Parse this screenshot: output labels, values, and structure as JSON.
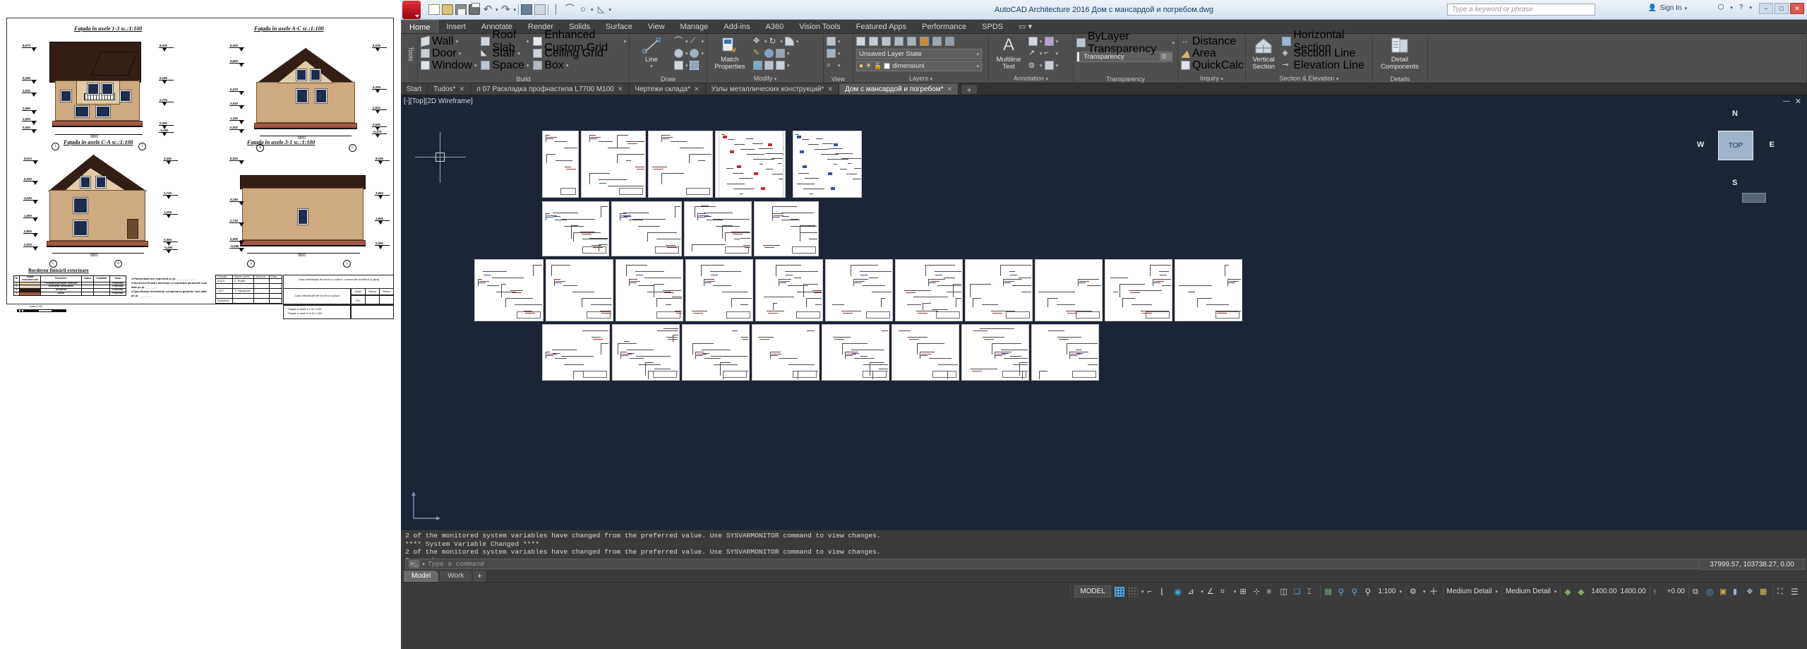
{
  "left_document": {
    "name": "facade-drawing-sheet",
    "titles": [
      "Fațada în axele 1-3 sc.:1:100",
      "Fațada în axele A-C sc.:1:100",
      "Fațada în axele C-A sc.:1:100",
      "Fațada în axele 3-1 sc.:1:100"
    ],
    "elev_left_1": [
      "8,070",
      "5,180",
      "3,930",
      "2,590",
      "1,500",
      "0,000"
    ],
    "elev_right_1": [
      "8,030",
      "5,180",
      "2,730",
      "0,000",
      "-0,450"
    ],
    "elev_left_2": [
      "8,000",
      "5,690",
      "5,220",
      "3,020",
      "1,150",
      "0,000"
    ],
    "elev_right_2": [
      "8,035",
      "5,205",
      "2,910",
      "0,000",
      "-0,470"
    ],
    "elev_left_3": [
      "8,023",
      "5,320",
      "3,020",
      "1,500",
      "0,800",
      "0,000"
    ],
    "elev_right_3": [
      "4,450",
      "2,730",
      "1,205",
      "0,000",
      "-0,450"
    ],
    "elev_left_4": [
      "8,020",
      "5,180",
      "2,730",
      "0,000",
      "-0,450"
    ],
    "elev_right_4": [
      "8,035",
      "3,863",
      "1,805",
      "0,000"
    ],
    "dims": [
      "9800",
      "6800",
      "8800",
      "9800"
    ],
    "axes_1": [
      "1",
      "3"
    ],
    "axes_2": [
      "A",
      "C"
    ],
    "axes_3": [
      "C",
      "A"
    ],
    "axes_4": [
      "3",
      "1"
    ],
    "borderou": {
      "title": "Borderou finisării exterioare",
      "headers": [
        "Nr",
        "Scara cromatic/culo",
        "Denumire",
        "Indice",
        "Cantitate",
        "Nota"
      ],
      "rows": [
        [
          "1",
          "",
          "Finisarea pereților exteriori",
          "",
          "",
          "Proiectat"
        ],
        [
          "2",
          "",
          "Elemente decorative",
          "",
          "",
          "Proiectat"
        ],
        [
          "3",
          "",
          "Acoperiș",
          "",
          "",
          "Proiectat"
        ],
        [
          "4",
          "",
          "Soclu",
          "",
          "",
          "Proiectat"
        ]
      ],
      "scale_label": "Scara 1:100"
    },
    "notes": [
      "1.Planșa dată vezi împreună cu pl. ____________.",
      "2.Borderoul finisare interioare și explicația pardoselii sunt",
      "   date pe pl. _______.",
      "3.Specificația elementelor completarea golurilor este dată",
      "   pe pl. ________."
    ],
    "title_block": {
      "headers": [
        "Funcția",
        "Nume, pren.",
        "Semnat",
        "Data"
      ],
      "rows": [
        [
          "A.Ș.P.",
          "V. Rotari",
          "",
          ""
        ],
        [
          "",
          "",
          "",
          ""
        ],
        [
          "I.Ș.P.",
          "T. Figurițcaia",
          "",
          ""
        ],
        [
          "",
          "",
          "",
          ""
        ],
        [
          "Îndeplinit",
          "",
          "",
          ""
        ]
      ],
      "project_title": "Casa individuală de locuit cu subsol, construcție auxiliară și garaj",
      "object_title": "Casa individuală de locuit cu subsol",
      "sheet_list": [
        "Fațada în axele 4-1 Sc 1:100",
        "Fațada în axele E-A Sc 1:100"
      ],
      "cols": [
        "Etapa",
        "Planșa",
        "Planșe"
      ],
      "stage": "P.E."
    }
  },
  "autocad": {
    "window_title": "AutoCAD Architecture 2016    Дом с мансардой и погребом.dwg",
    "search_placeholder": "Type a keyword or phrase",
    "sign_in": "Sign In",
    "window_buttons": [
      "−",
      "□",
      "✕"
    ],
    "quick_access": [
      "new-icon",
      "open-icon",
      "save-icon",
      "plot-icon",
      "undo-icon",
      "redo-icon",
      "match-icon",
      "sheetset-icon",
      "line-icon",
      "arc-icon",
      "circle-icon",
      "angle-icon"
    ],
    "ribbon_tabs": [
      {
        "label": "Home",
        "active": true
      },
      {
        "label": "Insert",
        "active": false
      },
      {
        "label": "Annotate",
        "active": false
      },
      {
        "label": "Render",
        "active": false
      },
      {
        "label": "Solids",
        "active": false
      },
      {
        "label": "Surface",
        "active": false
      },
      {
        "label": "View",
        "active": false
      },
      {
        "label": "Manage",
        "active": false
      },
      {
        "label": "Add-ins",
        "active": false
      },
      {
        "label": "A360",
        "active": false
      },
      {
        "label": "Vision Tools",
        "active": false
      },
      {
        "label": "Featured Apps",
        "active": false
      },
      {
        "label": "Performance",
        "active": false
      },
      {
        "label": "SPDS",
        "active": false
      }
    ],
    "panels": {
      "tools": {
        "name": "Tools",
        "label": "Tools"
      },
      "build": {
        "name": "Build",
        "col1": [
          "Wall",
          "Door",
          "Window"
        ],
        "col2": [
          "Roof Slab",
          "Stair",
          "Space"
        ],
        "col3": [
          "Enhanced Custom Grid",
          "Ceiling Grid",
          "Box"
        ]
      },
      "draw": {
        "name": "Draw",
        "line_label": "Line"
      },
      "modify": {
        "name": "Modify",
        "match_label_1": "Match",
        "match_label_2": "Properties"
      },
      "view": {
        "name": "View"
      },
      "layers": {
        "name": "Layers",
        "layer_state": "Unsaved Layer State",
        "current_layer": "dimensiuni"
      },
      "annotation": {
        "name": "Annotation",
        "multiline_1": "Multiline",
        "multiline_2": "Text"
      },
      "transparency": {
        "name": "Transparency",
        "bylayer": "ByLayer Transparency",
        "field_label": "Transparency",
        "field_value": "0"
      },
      "inquiry": {
        "name": "Inquiry",
        "items": [
          "Distance",
          "Area",
          "QuickCalc"
        ]
      },
      "section": {
        "name": "Section & Elevation",
        "vertical_1": "Vertical",
        "vertical_2": "Section",
        "items": [
          "Horizontal Section",
          "Section Line",
          "Elevation Line"
        ]
      },
      "details": {
        "name": "Details",
        "detail_1": "Detail",
        "detail_2": "Components"
      }
    },
    "document_tabs": [
      {
        "label": "Start",
        "active": false,
        "closable": false
      },
      {
        "label": "Tudos*",
        "active": false,
        "closable": true
      },
      {
        "label": "л 07 Раскладка профнастила L7700 M100",
        "active": false,
        "closable": true
      },
      {
        "label": "Чертежи склада*",
        "active": false,
        "closable": true
      },
      {
        "label": "Узлы металлических конструкций*",
        "active": false,
        "closable": true
      },
      {
        "label": "Дом с мансардой и погребом*",
        "active": true,
        "closable": true
      }
    ],
    "new_tab_label": "+",
    "viewport": {
      "label": "[-][Top][2D Wireframe]",
      "minimize": "—",
      "close": "✕",
      "viewcube": {
        "top": "TOP",
        "n": "N",
        "s": "S",
        "e": "E",
        "w": "W"
      }
    },
    "command_history": [
      "2 of the monitored system variables have changed from the preferred value. Use SYSVARMONITOR command to view changes.",
      "**** System Variable Changed ****",
      "2 of the monitored system variables have changed from the preferred value. Use SYSVARMONITOR command to view changes.",
      "Command:"
    ],
    "command_prompt": ">_",
    "command_placeholder": "Type a command",
    "layout_tabs": [
      {
        "label": "Model",
        "active": true
      },
      {
        "label": "Work",
        "active": false
      }
    ],
    "layout_plus": "+",
    "coordinates": "37999.57, 103738.27, 0.00",
    "status_bar": {
      "model_label": "MODEL",
      "scale": "1:100",
      "detail_1": "Medium Detail",
      "detail_2": "Medium Detail",
      "cut_plane_1": "1400.00",
      "cut_plane_2": "1400.00",
      "elevation": "+0.00",
      "icons": [
        "grid-icon",
        "snap-icon",
        "snap-dropdown-icon",
        "infer-constraints-icon",
        "ortho-icon",
        "polar-icon",
        "osnap-icon",
        "otrack-icon",
        "lineweight-icon",
        "transparency-icon",
        "selection-cycling-icon",
        "annotation-monitor-icon",
        "workspace-icon",
        "annotation-visibility-icon",
        "autoscale-icon",
        "isolate-objects-icon",
        "fullscreen-icon",
        "customization-icon"
      ]
    }
  },
  "colors": {
    "titlebar": "#d6e2ef",
    "ribbon": "#4f4f4f",
    "canvas": "#1c2535",
    "accent": "#9fb4c9",
    "close": "#d65b52"
  }
}
